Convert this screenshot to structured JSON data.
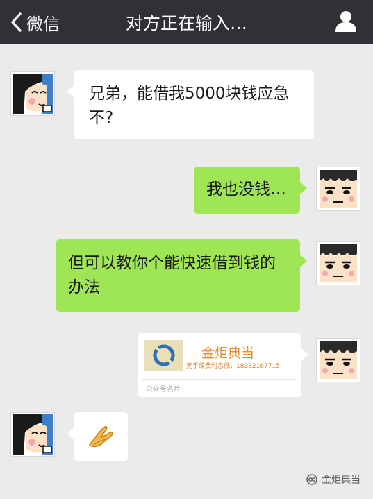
{
  "header": {
    "back_label": "微信",
    "title": "对方正在输入…",
    "back_icon": "chevron-left-icon",
    "user_icon": "person-icon"
  },
  "messages": [
    {
      "side": "left",
      "text": "兄弟，能借我5000块钱应急不?"
    },
    {
      "side": "right",
      "text": "我也没钱…"
    },
    {
      "side": "right",
      "text": "但可以教你个能快速借到钱的办法"
    }
  ],
  "card": {
    "name": "金炬典当",
    "description": "无手续费利息低：18382167715",
    "footer": "公众号名片"
  },
  "last_message": {
    "side": "left",
    "content": "emoji-hands-icon"
  },
  "watermark": {
    "text": "金炬典当",
    "icon": "wechat-official-icon"
  },
  "colors": {
    "topbar": "#2f3136",
    "background": "#ebebeb",
    "green_bubble": "#9fe657",
    "white_bubble": "#ffffff",
    "card_accent": "#e38a2a"
  }
}
